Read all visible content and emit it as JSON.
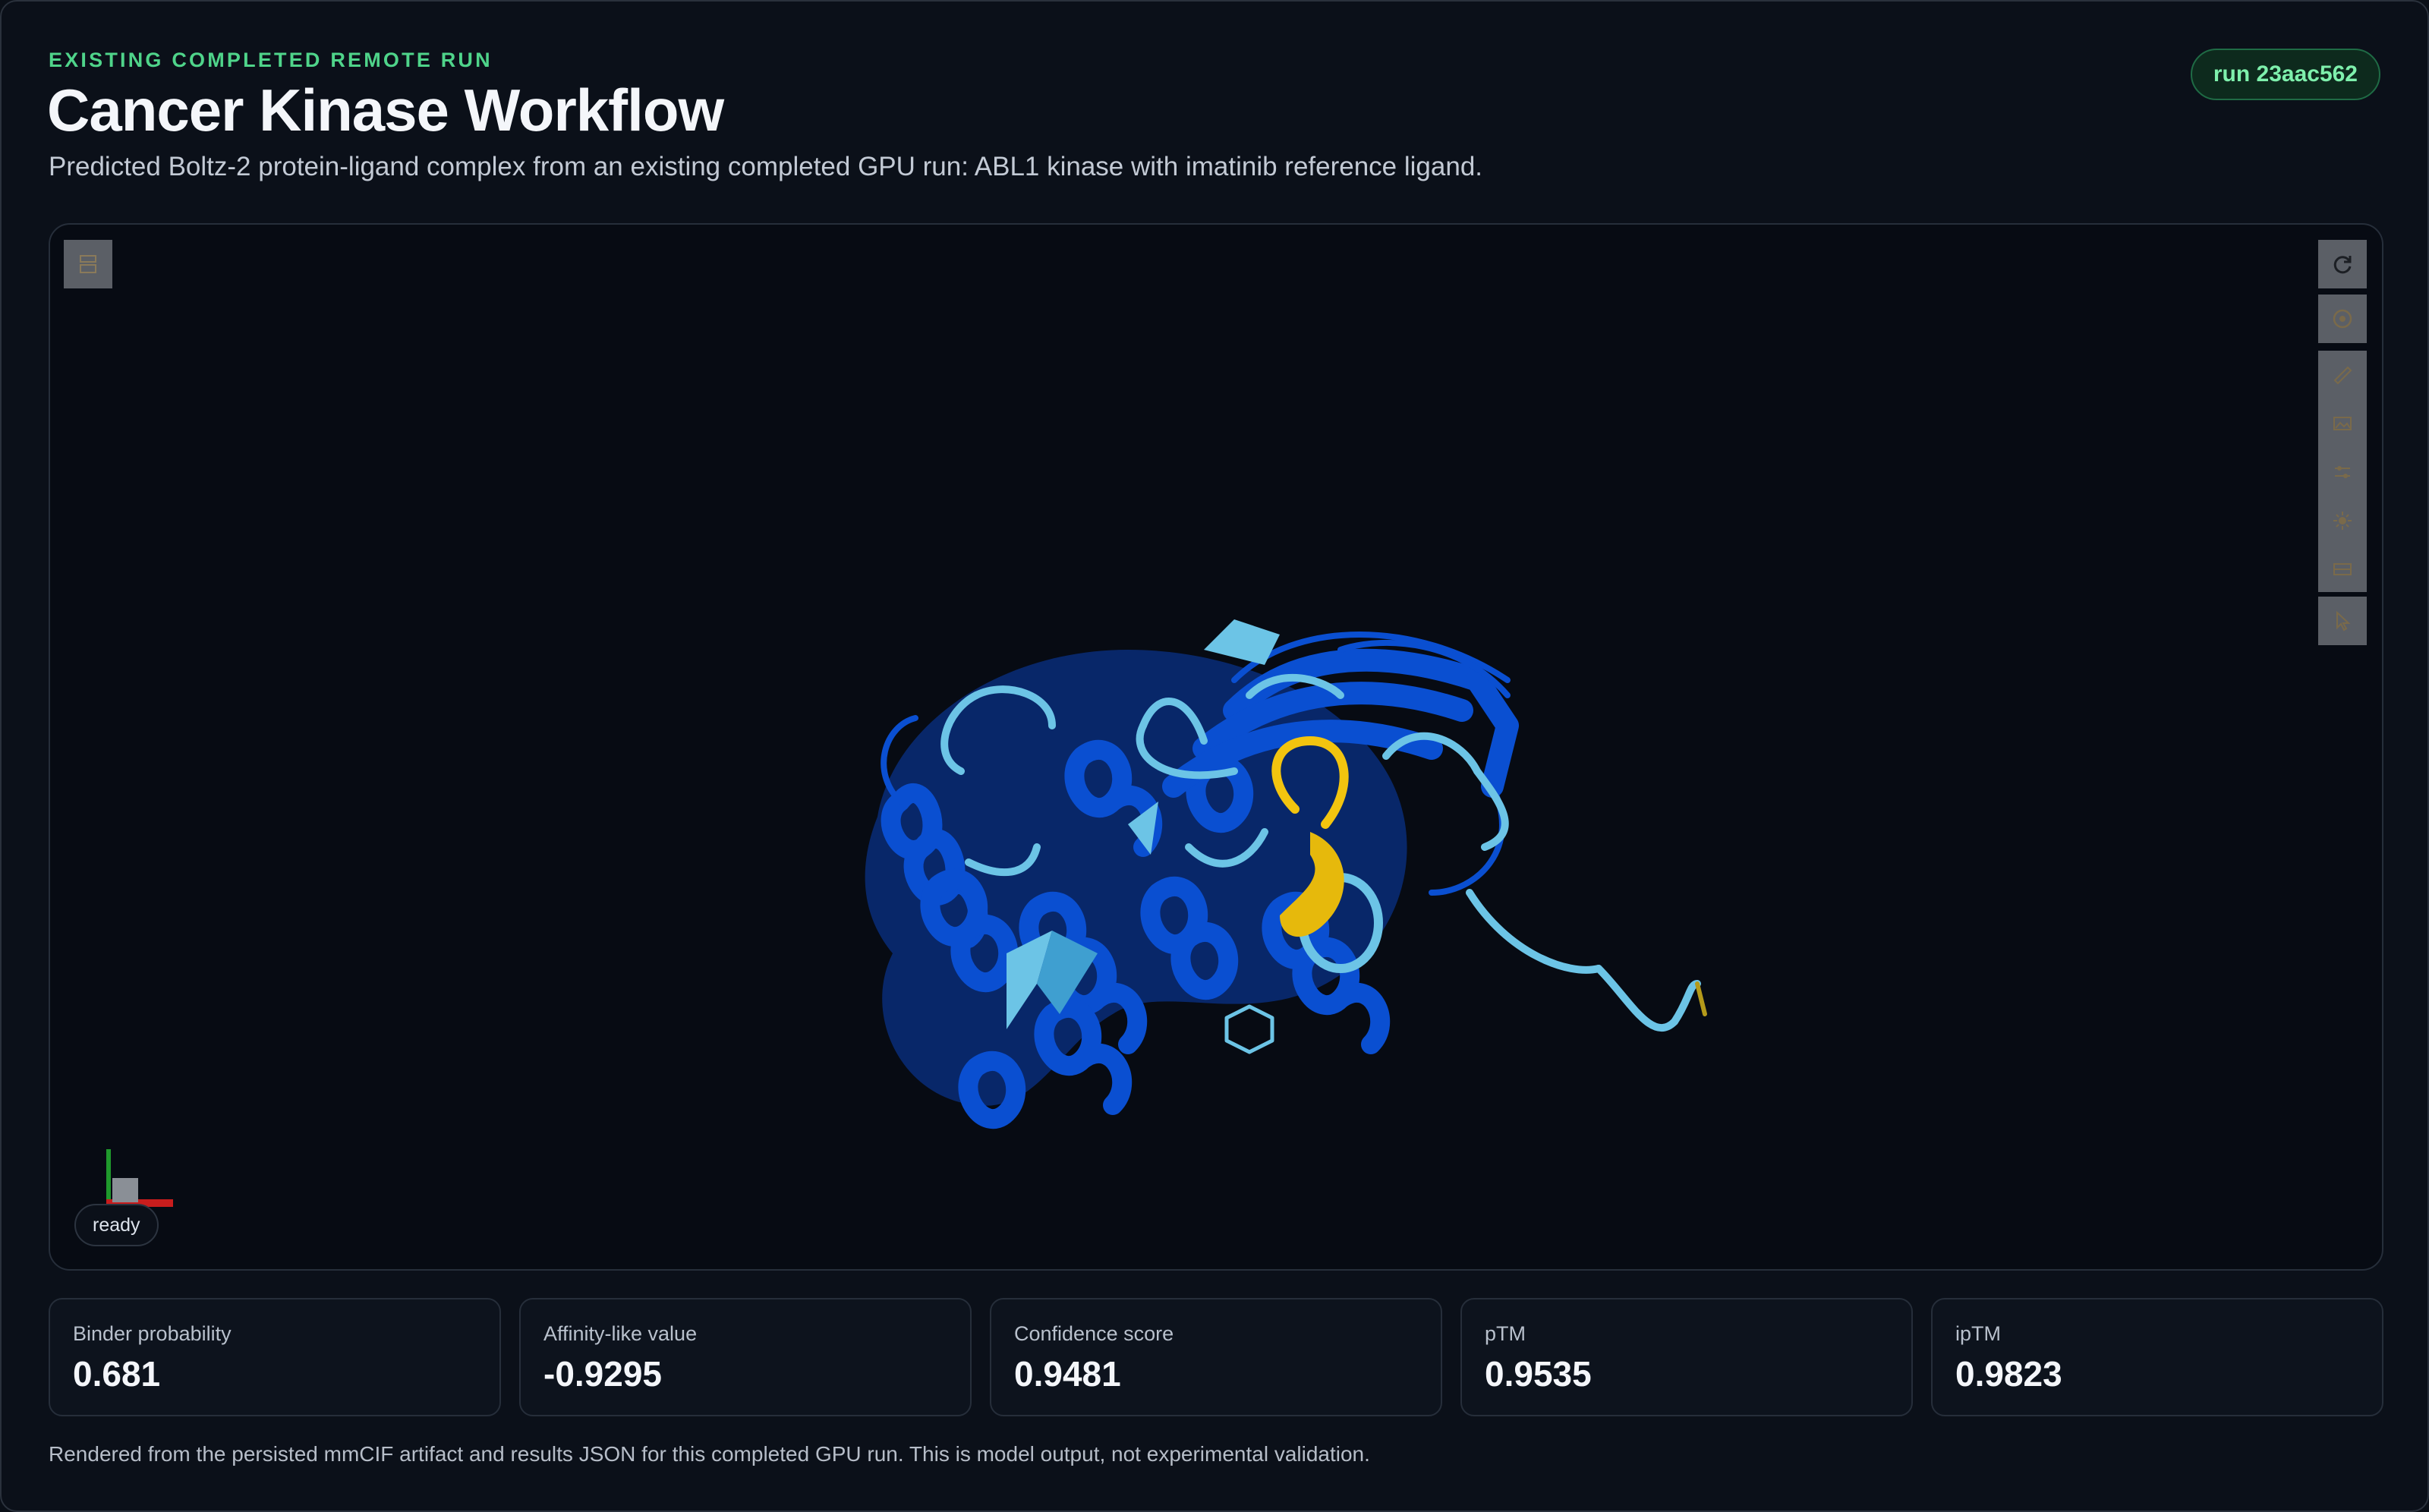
{
  "header": {
    "eyebrow": "EXISTING COMPLETED REMOTE RUN",
    "title": "Cancer Kinase Workflow",
    "subtitle": "Predicted Boltz-2 protein-ligand complex from an existing completed GPU run: ABL1 kinase with imatinib reference ligand.",
    "run_badge": "run 23aac562"
  },
  "viewer": {
    "status": "ready",
    "colors": {
      "protein_core": "#0a4fd1",
      "protein_loop": "#6cc4e6",
      "ligand_segment": "#f2c40f",
      "axis_x": "#c81d1d",
      "axis_y": "#1f9a2c",
      "axis_z": "#8a8f96"
    },
    "toolbar_icons": [
      "reset-view-icon",
      "focus-icon",
      "measure-icon",
      "screenshot-icon",
      "settings-icon",
      "lighting-icon",
      "overlay-icon",
      "select-mode-icon"
    ],
    "corner_icon": "structure-hierarchy-icon"
  },
  "metrics": [
    {
      "label": "Binder probability",
      "value": "0.681"
    },
    {
      "label": "Affinity-like value",
      "value": "-0.9295"
    },
    {
      "label": "Confidence score",
      "value": "0.9481"
    },
    {
      "label": "pTM",
      "value": "0.9535"
    },
    {
      "label": "ipTM",
      "value": "0.9823"
    }
  ],
  "footnote": "Rendered from the persisted mmCIF artifact and results JSON for this completed GPU run. This is model output, not experimental validation."
}
